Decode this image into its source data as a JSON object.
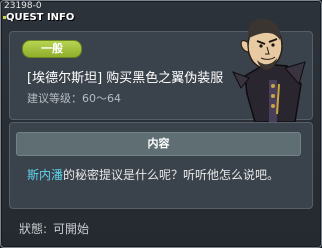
{
  "window": {
    "quest_id": "23198-0",
    "title": "QUEST INFO"
  },
  "quest": {
    "category_badge": "一般",
    "title": "[埃德尔斯坦] 购买黑色之翼伪装服",
    "level_requirement": "建议等级：60～64"
  },
  "content": {
    "header": "内容",
    "npc_name": "斯内潘",
    "description_rest": "的秘密提议是什么呢？听听他怎么说吧。"
  },
  "status": {
    "label": "狀態:",
    "value": "可開始"
  },
  "icons": {
    "npc": "npc-portrait-icon",
    "title_dot": "bullet-icon"
  },
  "colors": {
    "badge_green": "#9fc23a",
    "npc_name_cyan": "#5fd6ee",
    "panel_bg": "#3a424b"
  }
}
